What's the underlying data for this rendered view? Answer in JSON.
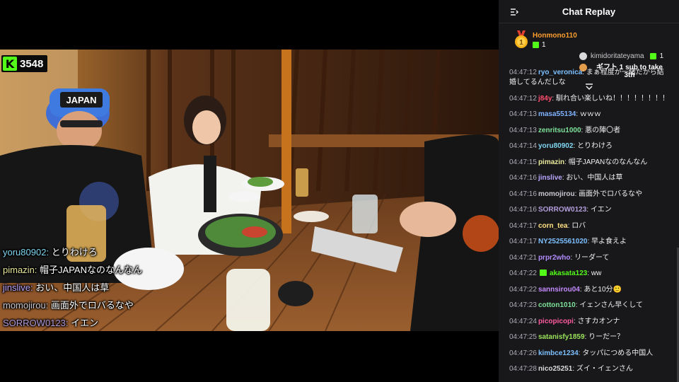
{
  "video": {
    "viewer_count": "3548",
    "platform_icon": "kick-logo-icon",
    "cap_text": "JAPAN",
    "overlay_chat": [
      {
        "user": "yoru80902",
        "sep": ": ",
        "text": "とりわけろ",
        "color": "#7fd6f0"
      },
      {
        "user": "pimazin",
        "sep": ": ",
        "text": "帽子JAPANなのなんなん",
        "color": "#e8e89a"
      },
      {
        "user": "jinslive",
        "sep": ": ",
        "text": "おい、中国人は草",
        "color": "#b9a6ff"
      },
      {
        "user": "momojirou",
        "sep": ": ",
        "text": "画面外でロバるなや",
        "color": "#c7c7d0"
      },
      {
        "user": "SORROW0123",
        "sep": ": ",
        "text": "イエン",
        "color": "#b39ddb"
      }
    ]
  },
  "chat": {
    "title": "Chat Replay",
    "collapse_icon": "collapse-arrow-icon",
    "pinned": {
      "left_user": "Honmono110",
      "left_count": "1",
      "right_user": "kimidoritateyama",
      "right_count": "1",
      "right_gift_text_1": "ギフト 1 sub to take",
      "right_gift_text_2": "3th"
    },
    "messages": [
      {
        "ts": "04:47:12",
        "user": "ryo_veronica",
        "color": "#7cc0ff",
        "text": "まぁ程度が一緒だから結婚してるんだしな",
        "badge": false
      },
      {
        "ts": "04:47:12",
        "user": "j84y",
        "color": "#ff4d6d",
        "text": "馴れ合い楽しいね！！！！！！！！",
        "badge": false
      },
      {
        "ts": "04:47:13",
        "user": "masa55134",
        "color": "#7fb2ff",
        "text": "ｗｗｗ",
        "badge": false
      },
      {
        "ts": "04:47:13",
        "user": "zenritsu1000",
        "color": "#7fe29a",
        "text": "悪の陣〇者",
        "badge": false
      },
      {
        "ts": "04:47:14",
        "user": "yoru80902",
        "color": "#7fd6f0",
        "text": "とりわけろ",
        "badge": false
      },
      {
        "ts": "04:47:15",
        "user": "pimazin",
        "color": "#e8e89a",
        "text": "帽子JAPANなのなんなん",
        "badge": false
      },
      {
        "ts": "04:47:16",
        "user": "jinslive",
        "color": "#b9a6ff",
        "text": "おい、中国人は草",
        "badge": false
      },
      {
        "ts": "04:47:16",
        "user": "momojirou",
        "color": "#c7c7d0",
        "text": "画面外でロバるなや",
        "badge": false
      },
      {
        "ts": "04:47:16",
        "user": "SORROW0123",
        "color": "#b39ddb",
        "text": "イエン",
        "badge": false
      },
      {
        "ts": "04:47:17",
        "user": "corn_tea",
        "color": "#ffe082",
        "text": "ロバ",
        "badge": false
      },
      {
        "ts": "04:47:17",
        "user": "NY2525561020",
        "color": "#7cc0ff",
        "text": "早よ食えよ",
        "badge": false
      },
      {
        "ts": "04:47:21",
        "user": "prpr2who",
        "color": "#b28bff",
        "text": "リーダーて",
        "badge": false
      },
      {
        "ts": "04:47:22",
        "user": "akasata123",
        "color": "#53fc18",
        "text": "ww",
        "badge": true
      },
      {
        "ts": "04:47:22",
        "user": "sannsirou04",
        "color": "#c58bff",
        "text": "あと10分🙂",
        "badge": false
      },
      {
        "ts": "04:47:23",
        "user": "cotton1010",
        "color": "#7fe29a",
        "text": "イェンさん早くして",
        "badge": false
      },
      {
        "ts": "04:47:24",
        "user": "picopicopi",
        "color": "#ff5a9f",
        "text": "さすカオンナ",
        "badge": false
      },
      {
        "ts": "04:47:25",
        "user": "satanisfy1859",
        "color": "#9be35a",
        "text": "りーだー？",
        "badge": false
      },
      {
        "ts": "04:47:26",
        "user": "kimbce1234",
        "color": "#7cc0ff",
        "text": "タッパにつめる中国人",
        "badge": false
      },
      {
        "ts": "04:47:28",
        "user": "nico25251",
        "color": "#dcdcdc",
        "text": "ズイ・イェンさん",
        "badge": false
      }
    ]
  }
}
